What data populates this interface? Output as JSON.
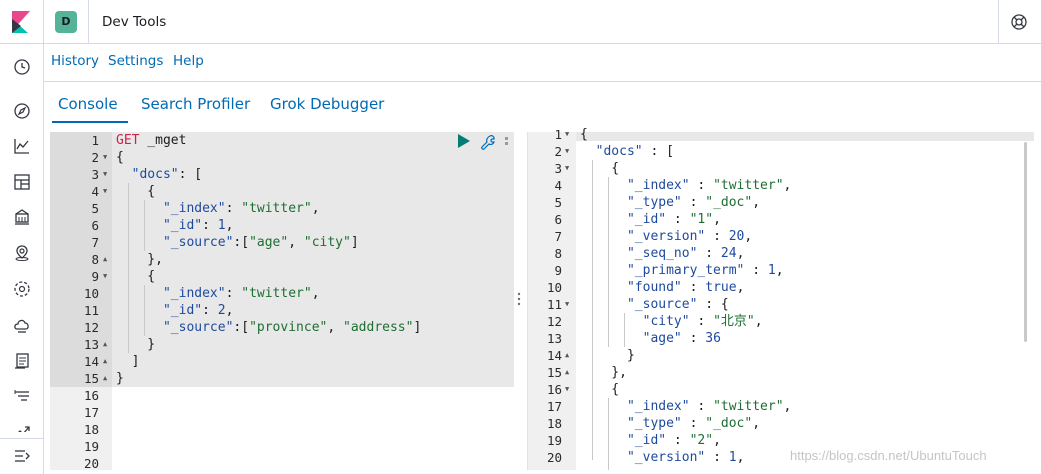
{
  "header": {
    "space_initial": "D",
    "app_title": "Dev Tools",
    "icons": {
      "logo": "kibana-logo",
      "help": "lifebuoy-icon"
    },
    "space_color": "#54B399"
  },
  "left_nav": {
    "icons": [
      "clock-icon",
      "compass-icon",
      "chart-icon",
      "dashboard-icon",
      "canvas-icon",
      "maps-icon",
      "ml-icon",
      "infrastructure-icon",
      "logs-icon",
      "apm-icon",
      "uptime-icon",
      "collapse-icon"
    ]
  },
  "top_menu": {
    "history": "History",
    "settings": "Settings",
    "help": "Help"
  },
  "tabs": {
    "console": "Console",
    "search_profiler": "Search Profiler",
    "grok_debugger": "Grok Debugger",
    "active": "Console"
  },
  "input_editor": {
    "method": "GET",
    "path": " _mget",
    "line_numbers": [
      "1",
      "2",
      "3",
      "4",
      "5",
      "6",
      "7",
      "8",
      "9",
      "10",
      "11",
      "12",
      "13",
      "14",
      "15",
      "16",
      "17",
      "18",
      "19",
      "20"
    ],
    "lines": [
      "{",
      "  \"docs\": [",
      "    {",
      "      \"_index\": \"twitter\",",
      "      \"_id\": 1,",
      "      \"_source\":[\"age\", \"city\"]",
      "    },",
      "    {",
      "      \"_index\": \"twitter\",",
      "      \"_id\": 2,",
      "      \"_source\":[\"province\", \"address\"]",
      "    }",
      "  ]",
      "}"
    ]
  },
  "output_editor": {
    "line_numbers": [
      "1",
      "2",
      "3",
      "4",
      "5",
      "6",
      "7",
      "8",
      "9",
      "10",
      "11",
      "12",
      "13",
      "14",
      "15",
      "16",
      "17",
      "18",
      "19",
      "20"
    ],
    "lines": [
      "{",
      "  \"docs\" : [",
      "    {",
      "      \"_index\" : \"twitter\",",
      "      \"_type\" : \"_doc\",",
      "      \"_id\" : \"1\",",
      "      \"_version\" : 20,",
      "      \"_seq_no\" : 24,",
      "      \"_primary_term\" : 1,",
      "      \"found\" : true,",
      "      \"_source\" : {",
      "        \"city\" : \"北京\",",
      "        \"age\" : 36",
      "      }",
      "    },",
      "    {",
      "      \"_index\" : \"twitter\",",
      "      \"_type\" : \"_doc\",",
      "      \"_id\" : \"2\",",
      "      \"_version\" : 1,"
    ]
  },
  "watermark": "https://blog.csdn.net/UbuntuTouch",
  "colors": {
    "link": "#006BB4",
    "border": "#D3DAE6",
    "method": "#C7254E",
    "string": "#1E6E33",
    "run_button": "#017D73"
  }
}
